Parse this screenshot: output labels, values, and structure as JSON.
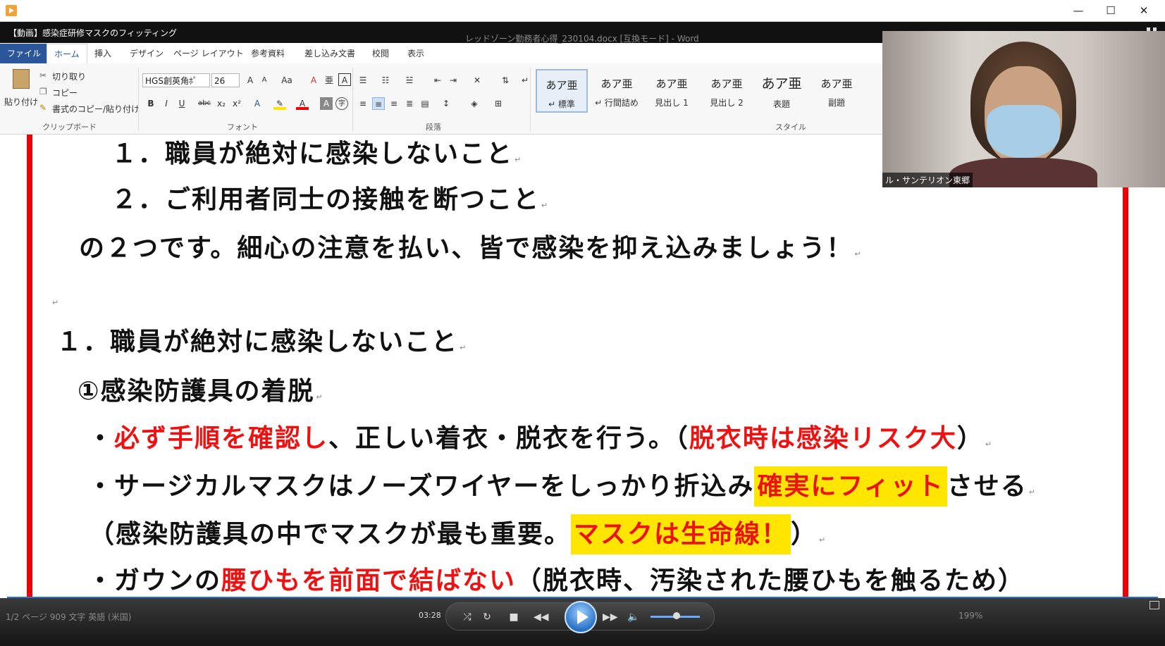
{
  "window": {
    "minimize": "—",
    "maximize": "☐",
    "close": "✕"
  },
  "video": {
    "title": "【動画】感染症研修マスクのフィッティング",
    "doc_window_title": "レッドゾーン勤務者心得_230104.docx [互換モード] - Word"
  },
  "ribbon": {
    "tabs": [
      "ファイル",
      "ホーム",
      "挿入",
      "デザイン",
      "ページ レイアウト",
      "参考資料",
      "差し込み文書",
      "校閲",
      "表示"
    ],
    "clipboard": {
      "paste": "貼り付け",
      "cut": "切り取り",
      "copy": "コピー",
      "format_painter": "書式のコピー/貼り付け",
      "label": "クリップボード"
    },
    "font": {
      "name": "HGS創英角ﾎﾟ",
      "size": "26",
      "label": "フォント"
    },
    "paragraph": {
      "label": "段落"
    },
    "styles": {
      "label": "スタイル",
      "items": [
        {
          "sample": "あア亜",
          "name": "↵ 標準"
        },
        {
          "sample": "あア亜",
          "name": "↵ 行間詰め"
        },
        {
          "sample": "あア亜",
          "name": "見出し 1"
        },
        {
          "sample": "あア亜",
          "name": "見出し 2"
        },
        {
          "sample": "あア亜",
          "name": "表題"
        },
        {
          "sample": "あア亜",
          "name": "副題"
        }
      ]
    }
  },
  "document": {
    "l1": "１．職員が絶対に感染しないこと",
    "l2": "２．ご利用者同士の接触を断つこと",
    "l3": "の２つです。細心の注意を払い、皆で感染を抑え込みましょう！",
    "h1": "１．職員が絶対に感染しないこと",
    "h2": "①感染防護具の着脱",
    "b1_a": "・",
    "b1_b": "必ず手順を確認し",
    "b1_c": "、正しい着衣・脱衣を行う。（",
    "b1_d": "脱衣時は感染リスク大",
    "b1_e": "）",
    "b2_a": "・サージカルマスクはノーズワイヤーをしっかり折込み",
    "b2_b": "確実にフィット",
    "b2_c": "させる",
    "b3_a": "（感染防護具の中でマスクが最も重要。",
    "b3_b": "マスクは生命線！",
    "b3_c": "）",
    "b4_a": "・ガウンの",
    "b4_b": "腰ひもを前面で結ばない",
    "b4_c": "（脱衣時、汚染された腰ひもを触るため）",
    "para_mark": "↵"
  },
  "webcam": {
    "name": "ル・サンテリオン東郷"
  },
  "player": {
    "status_left": "1/2 ページ   909 文字     英語 (米国)",
    "time": "03:28",
    "zoom": "199%"
  },
  "colors": {
    "accent_red": "#e11111",
    "highlight": "#ffe600",
    "word_blue": "#2b579a"
  }
}
